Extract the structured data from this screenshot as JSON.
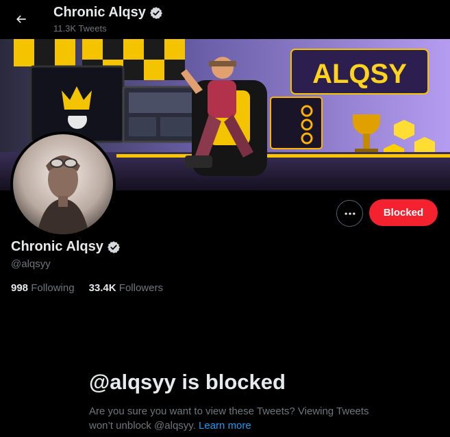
{
  "header": {
    "name": "Chronic Alqsy",
    "tweet_count": "11.3K Tweets"
  },
  "banner": {
    "sign_text": "ALQSY",
    "accent_color": "#f5c400"
  },
  "profile": {
    "name": "Chronic Alqsy",
    "handle": "@alqsyy",
    "following_count": "998",
    "following_label": "Following",
    "followers_count": "33.4K",
    "followers_label": "Followers",
    "blocked_button_label": "Blocked",
    "blocked_button_color": "#f4212e"
  },
  "blocked_notice": {
    "title": "@alqsyy is blocked",
    "description": "Are you sure you want to view these Tweets? Viewing Tweets won’t unblock @alqsyy.",
    "link_label": "Learn more",
    "link_color": "#1d9bf0"
  },
  "icons": {
    "back": "arrow-left-icon",
    "verified": "verified-badge-icon",
    "more": "more-dots-icon"
  }
}
